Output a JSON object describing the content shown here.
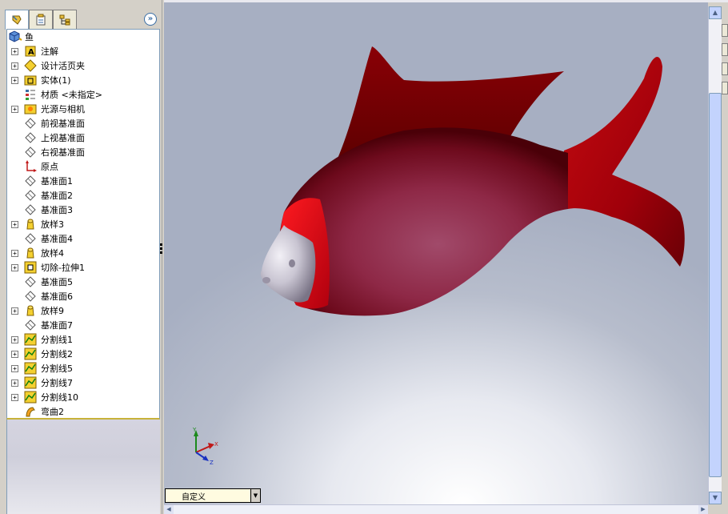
{
  "tree": {
    "root_label": "鱼",
    "items": [
      {
        "label": "注解",
        "icon": "annotation-icon",
        "expand": "+"
      },
      {
        "label": "设计活页夹",
        "icon": "design-binder-icon",
        "expand": "+"
      },
      {
        "label": "实体(1)",
        "icon": "solid-bodies-icon",
        "expand": "+"
      },
      {
        "label": "材质 <未指定>",
        "icon": "material-icon",
        "expand": ""
      },
      {
        "label": "光源与相机",
        "icon": "lights-cameras-icon",
        "expand": "+"
      },
      {
        "label": "前视基准面",
        "icon": "plane-icon",
        "expand": ""
      },
      {
        "label": "上视基准面",
        "icon": "plane-icon",
        "expand": ""
      },
      {
        "label": "右视基准面",
        "icon": "plane-icon",
        "expand": ""
      },
      {
        "label": "原点",
        "icon": "origin-icon",
        "expand": ""
      },
      {
        "label": "基准面1",
        "icon": "plane-icon",
        "expand": ""
      },
      {
        "label": "基准面2",
        "icon": "plane-icon",
        "expand": ""
      },
      {
        "label": "基准面3",
        "icon": "plane-icon",
        "expand": ""
      },
      {
        "label": "放样3",
        "icon": "loft-icon",
        "expand": "+"
      },
      {
        "label": "基准面4",
        "icon": "plane-icon",
        "expand": ""
      },
      {
        "label": "放样4",
        "icon": "loft-icon",
        "expand": "+"
      },
      {
        "label": "切除-拉伸1",
        "icon": "cut-extrude-icon",
        "expand": "+"
      },
      {
        "label": "基准面5",
        "icon": "plane-icon",
        "expand": ""
      },
      {
        "label": "基准面6",
        "icon": "plane-icon",
        "expand": ""
      },
      {
        "label": "放样9",
        "icon": "loft-icon",
        "expand": "+"
      },
      {
        "label": "基准面7",
        "icon": "plane-icon",
        "expand": ""
      },
      {
        "label": "分割线1",
        "icon": "split-line-icon",
        "expand": "+"
      },
      {
        "label": "分割线2",
        "icon": "split-line-icon",
        "expand": "+"
      },
      {
        "label": "分割线5",
        "icon": "split-line-icon",
        "expand": "+"
      },
      {
        "label": "分割线7",
        "icon": "split-line-icon",
        "expand": "+"
      },
      {
        "label": "分割线10",
        "icon": "split-line-icon",
        "expand": "+"
      },
      {
        "label": "弯曲2",
        "icon": "flex-icon",
        "expand": ""
      }
    ]
  },
  "view_orientation": {
    "selected": "自定义"
  },
  "triad": {
    "x": "X",
    "y": "Y",
    "z": "Z"
  },
  "colors": {
    "fish_body": "#b0182a",
    "fish_dark": "#6a0000",
    "fish_nose": "#c9c5d2",
    "tree_border": "#7f9db9"
  }
}
